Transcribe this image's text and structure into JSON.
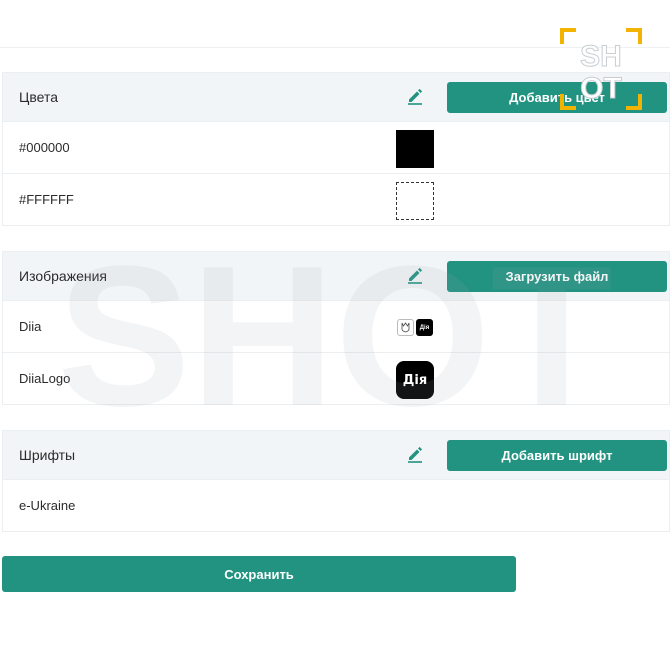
{
  "colors_section": {
    "title": "Цвета",
    "button_label": "Добавить цвет",
    "items": [
      {
        "label": "#000000",
        "swatch": "#000000"
      },
      {
        "label": "#FFFFFF",
        "swatch": "#FFFFFF"
      }
    ]
  },
  "images_section": {
    "title": "Изображения",
    "button_label": "Загрузить файл",
    "items": [
      {
        "label": "Diia",
        "preview_text": "Дія"
      },
      {
        "label": "DiiaLogo",
        "preview_text": "Дія"
      }
    ]
  },
  "fonts_section": {
    "title": "Шрифты",
    "button_label": "Добавить шрифт",
    "items": [
      {
        "label": "e-Ukraine"
      }
    ]
  },
  "save_label": "Сохранить",
  "watermark": {
    "text": "SHOT"
  },
  "theme": {
    "accent": "#229381",
    "header_bg": "#f2f5f7"
  },
  "icons": {
    "edit": "pencil-icon"
  }
}
